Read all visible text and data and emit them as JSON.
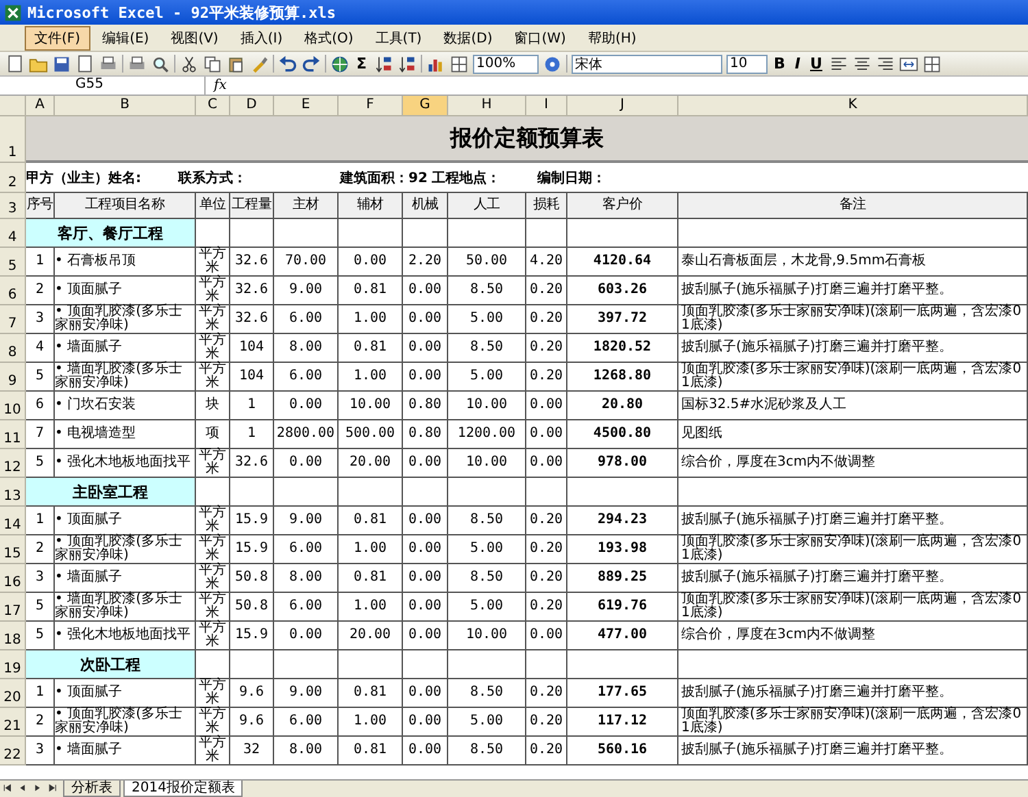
{
  "window": {
    "title": "Microsoft Excel - 92平米装修预算.xls"
  },
  "menu": [
    {
      "label": "文件(F)",
      "selected": true
    },
    {
      "label": "编辑(E)",
      "selected": false
    },
    {
      "label": "视图(V)",
      "selected": false
    },
    {
      "label": "插入(I)",
      "selected": false
    },
    {
      "label": "格式(O)",
      "selected": false
    },
    {
      "label": "工具(T)",
      "selected": false
    },
    {
      "label": "数据(D)",
      "selected": false
    },
    {
      "label": "窗口(W)",
      "selected": false
    },
    {
      "label": "帮助(H)",
      "selected": false
    }
  ],
  "toolbar": {
    "sum": "Σ",
    "zoom": "100%",
    "font": "宋体",
    "font_size": "10",
    "bold": "B",
    "italic": "I",
    "underline": "U"
  },
  "formula_bar": {
    "name_box": "G55",
    "fx": "fx"
  },
  "sheet": {
    "column_letters": [
      {
        "label": "A",
        "selected": false
      },
      {
        "label": "B",
        "selected": false
      },
      {
        "label": "C",
        "selected": false
      },
      {
        "label": "D",
        "selected": false
      },
      {
        "label": "E",
        "selected": false
      },
      {
        "label": "F",
        "selected": false
      },
      {
        "label": "G",
        "selected": true
      },
      {
        "label": "H",
        "selected": false
      },
      {
        "label": "I",
        "selected": false
      },
      {
        "label": "J",
        "selected": false
      },
      {
        "label": "K",
        "selected": false
      }
    ],
    "title_row": {
      "number": "1",
      "text": "报价定额预算表"
    },
    "info_row": {
      "number": "2",
      "fields": [
        "甲方（业主）姓名:",
        "联系方式：",
        "建筑面积：92",
        "工程地点：",
        "编制日期："
      ]
    },
    "header_row": {
      "number": "3",
      "cells": [
        "序号",
        "工程项目名称",
        "单位",
        "工程量",
        "主材",
        "辅材",
        "机械",
        "人工",
        "损耗",
        "客户价",
        "备注"
      ]
    },
    "rows": [
      {
        "number": "4",
        "kind": "section",
        "title": "客厅、餐厅工程"
      },
      {
        "number": "5",
        "kind": "item",
        "cells": [
          "1",
          "• 石膏板吊顶",
          "平方米",
          "32.6",
          "70.00",
          "0.00",
          "2.20",
          "50.00",
          "4.20",
          "4120.64",
          "泰山石膏板面层，木龙骨,9.5mm石膏板"
        ]
      },
      {
        "number": "6",
        "kind": "item",
        "cells": [
          "2",
          "• 顶面腻子",
          "平方米",
          "32.6",
          "9.00",
          "0.81",
          "0.00",
          "8.50",
          "0.20",
          "603.26",
          "披刮腻子(施乐福腻子)打磨三遍并打磨平整。"
        ]
      },
      {
        "number": "7",
        "kind": "item",
        "cells": [
          "3",
          "• 顶面乳胶漆(多乐士家丽安净味)",
          "平方米",
          "32.6",
          "6.00",
          "1.00",
          "0.00",
          "5.00",
          "0.20",
          "397.72",
          "顶面乳胶漆(多乐士家丽安净味)(滚刷一底两遍，含宏漆01底漆)"
        ]
      },
      {
        "number": "8",
        "kind": "item",
        "cells": [
          "4",
          "• 墙面腻子",
          "平方米",
          "104",
          "8.00",
          "0.81",
          "0.00",
          "8.50",
          "0.20",
          "1820.52",
          "披刮腻子(施乐福腻子)打磨三遍并打磨平整。"
        ]
      },
      {
        "number": "9",
        "kind": "item",
        "cells": [
          "5",
          "• 墙面乳胶漆(多乐士家丽安净味)",
          "平方米",
          "104",
          "6.00",
          "1.00",
          "0.00",
          "5.00",
          "0.20",
          "1268.80",
          "顶面乳胶漆(多乐士家丽安净味)(滚刷一底两遍，含宏漆01底漆)"
        ]
      },
      {
        "number": "10",
        "kind": "item",
        "cells": [
          "6",
          "• 门坎石安装",
          "块",
          "1",
          "0.00",
          "10.00",
          "0.80",
          "10.00",
          "0.00",
          "20.80",
          "国标32.5#水泥砂浆及人工"
        ]
      },
      {
        "number": "11",
        "kind": "item",
        "cells": [
          "7",
          "• 电视墙造型",
          "项",
          "1",
          "2800.00",
          "500.00",
          "0.80",
          "1200.00",
          "0.00",
          "4500.80",
          "见图纸"
        ]
      },
      {
        "number": "12",
        "kind": "item",
        "cells": [
          "5",
          "• 强化木地板地面找平",
          "平方米",
          "32.6",
          "0.00",
          "20.00",
          "0.00",
          "10.00",
          "0.00",
          "978.00",
          "综合价，厚度在3cm内不做调整"
        ]
      },
      {
        "number": "13",
        "kind": "section",
        "title": "主卧室工程"
      },
      {
        "number": "14",
        "kind": "item",
        "cells": [
          "1",
          "• 顶面腻子",
          "平方米",
          "15.9",
          "9.00",
          "0.81",
          "0.00",
          "8.50",
          "0.20",
          "294.23",
          "披刮腻子(施乐福腻子)打磨三遍并打磨平整。"
        ]
      },
      {
        "number": "15",
        "kind": "item",
        "cells": [
          "2",
          "• 顶面乳胶漆(多乐士家丽安净味)",
          "平方米",
          "15.9",
          "6.00",
          "1.00",
          "0.00",
          "5.00",
          "0.20",
          "193.98",
          "顶面乳胶漆(多乐士家丽安净味)(滚刷一底两遍，含宏漆01底漆)"
        ]
      },
      {
        "number": "16",
        "kind": "item",
        "cells": [
          "3",
          "• 墙面腻子",
          "平方米",
          "50.8",
          "8.00",
          "0.81",
          "0.00",
          "8.50",
          "0.20",
          "889.25",
          "披刮腻子(施乐福腻子)打磨三遍并打磨平整。"
        ]
      },
      {
        "number": "17",
        "kind": "item",
        "cells": [
          "5",
          "• 墙面乳胶漆(多乐士家丽安净味)",
          "平方米",
          "50.8",
          "6.00",
          "1.00",
          "0.00",
          "5.00",
          "0.20",
          "619.76",
          "顶面乳胶漆(多乐士家丽安净味)(滚刷一底两遍，含宏漆01底漆)"
        ]
      },
      {
        "number": "18",
        "kind": "item",
        "cells": [
          "5",
          "• 强化木地板地面找平",
          "平方米",
          "15.9",
          "0.00",
          "20.00",
          "0.00",
          "10.00",
          "0.00",
          "477.00",
          "综合价，厚度在3cm内不做调整"
        ]
      },
      {
        "number": "19",
        "kind": "section",
        "title": "次卧工程"
      },
      {
        "number": "20",
        "kind": "item",
        "cells": [
          "1",
          "• 顶面腻子",
          "平方米",
          "9.6",
          "9.00",
          "0.81",
          "0.00",
          "8.50",
          "0.20",
          "177.65",
          "披刮腻子(施乐福腻子)打磨三遍并打磨平整。"
        ]
      },
      {
        "number": "21",
        "kind": "item",
        "cells": [
          "2",
          "• 顶面乳胶漆(多乐士家丽安净味)",
          "平方米",
          "9.6",
          "6.00",
          "1.00",
          "0.00",
          "5.00",
          "0.20",
          "117.12",
          "顶面乳胶漆(多乐士家丽安净味)(滚刷一底两遍，含宏漆01底漆)"
        ]
      },
      {
        "number": "22",
        "kind": "item",
        "cells": [
          "3",
          "• 墙面腻子",
          "平方米",
          "32",
          "8.00",
          "0.81",
          "0.00",
          "8.50",
          "0.20",
          "560.16",
          "披刮腻子(施乐福腻子)打磨三遍并打磨平整。"
        ]
      }
    ]
  },
  "sheet_tabs": [
    {
      "label": "分析表",
      "selected": false
    },
    {
      "label": "2014报价定额表",
      "selected": true
    }
  ]
}
